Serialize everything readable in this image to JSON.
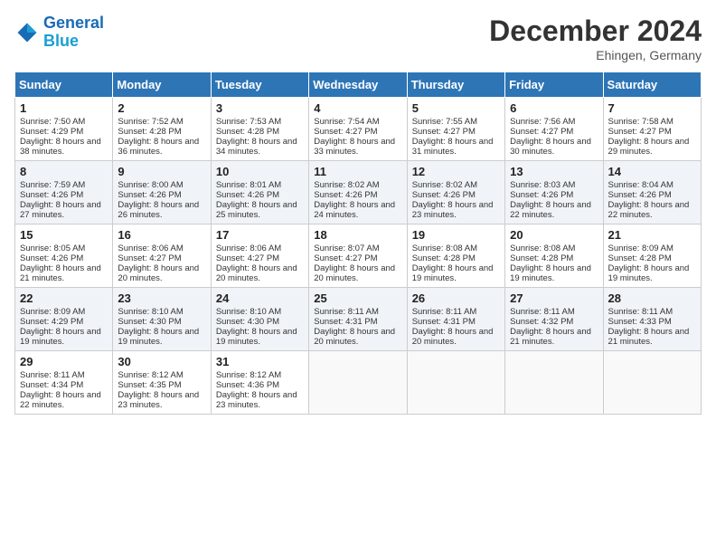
{
  "header": {
    "logo_line1": "General",
    "logo_line2": "Blue",
    "month": "December 2024",
    "location": "Ehingen, Germany"
  },
  "days_of_week": [
    "Sunday",
    "Monday",
    "Tuesday",
    "Wednesday",
    "Thursday",
    "Friday",
    "Saturday"
  ],
  "weeks": [
    [
      {
        "day": 1,
        "sunrise": "Sunrise: 7:50 AM",
        "sunset": "Sunset: 4:29 PM",
        "daylight": "Daylight: 8 hours and 38 minutes."
      },
      {
        "day": 2,
        "sunrise": "Sunrise: 7:52 AM",
        "sunset": "Sunset: 4:28 PM",
        "daylight": "Daylight: 8 hours and 36 minutes."
      },
      {
        "day": 3,
        "sunrise": "Sunrise: 7:53 AM",
        "sunset": "Sunset: 4:28 PM",
        "daylight": "Daylight: 8 hours and 34 minutes."
      },
      {
        "day": 4,
        "sunrise": "Sunrise: 7:54 AM",
        "sunset": "Sunset: 4:27 PM",
        "daylight": "Daylight: 8 hours and 33 minutes."
      },
      {
        "day": 5,
        "sunrise": "Sunrise: 7:55 AM",
        "sunset": "Sunset: 4:27 PM",
        "daylight": "Daylight: 8 hours and 31 minutes."
      },
      {
        "day": 6,
        "sunrise": "Sunrise: 7:56 AM",
        "sunset": "Sunset: 4:27 PM",
        "daylight": "Daylight: 8 hours and 30 minutes."
      },
      {
        "day": 7,
        "sunrise": "Sunrise: 7:58 AM",
        "sunset": "Sunset: 4:27 PM",
        "daylight": "Daylight: 8 hours and 29 minutes."
      }
    ],
    [
      {
        "day": 8,
        "sunrise": "Sunrise: 7:59 AM",
        "sunset": "Sunset: 4:26 PM",
        "daylight": "Daylight: 8 hours and 27 minutes."
      },
      {
        "day": 9,
        "sunrise": "Sunrise: 8:00 AM",
        "sunset": "Sunset: 4:26 PM",
        "daylight": "Daylight: 8 hours and 26 minutes."
      },
      {
        "day": 10,
        "sunrise": "Sunrise: 8:01 AM",
        "sunset": "Sunset: 4:26 PM",
        "daylight": "Daylight: 8 hours and 25 minutes."
      },
      {
        "day": 11,
        "sunrise": "Sunrise: 8:02 AM",
        "sunset": "Sunset: 4:26 PM",
        "daylight": "Daylight: 8 hours and 24 minutes."
      },
      {
        "day": 12,
        "sunrise": "Sunrise: 8:02 AM",
        "sunset": "Sunset: 4:26 PM",
        "daylight": "Daylight: 8 hours and 23 minutes."
      },
      {
        "day": 13,
        "sunrise": "Sunrise: 8:03 AM",
        "sunset": "Sunset: 4:26 PM",
        "daylight": "Daylight: 8 hours and 22 minutes."
      },
      {
        "day": 14,
        "sunrise": "Sunrise: 8:04 AM",
        "sunset": "Sunset: 4:26 PM",
        "daylight": "Daylight: 8 hours and 22 minutes."
      }
    ],
    [
      {
        "day": 15,
        "sunrise": "Sunrise: 8:05 AM",
        "sunset": "Sunset: 4:26 PM",
        "daylight": "Daylight: 8 hours and 21 minutes."
      },
      {
        "day": 16,
        "sunrise": "Sunrise: 8:06 AM",
        "sunset": "Sunset: 4:27 PM",
        "daylight": "Daylight: 8 hours and 20 minutes."
      },
      {
        "day": 17,
        "sunrise": "Sunrise: 8:06 AM",
        "sunset": "Sunset: 4:27 PM",
        "daylight": "Daylight: 8 hours and 20 minutes."
      },
      {
        "day": 18,
        "sunrise": "Sunrise: 8:07 AM",
        "sunset": "Sunset: 4:27 PM",
        "daylight": "Daylight: 8 hours and 20 minutes."
      },
      {
        "day": 19,
        "sunrise": "Sunrise: 8:08 AM",
        "sunset": "Sunset: 4:28 PM",
        "daylight": "Daylight: 8 hours and 19 minutes."
      },
      {
        "day": 20,
        "sunrise": "Sunrise: 8:08 AM",
        "sunset": "Sunset: 4:28 PM",
        "daylight": "Daylight: 8 hours and 19 minutes."
      },
      {
        "day": 21,
        "sunrise": "Sunrise: 8:09 AM",
        "sunset": "Sunset: 4:28 PM",
        "daylight": "Daylight: 8 hours and 19 minutes."
      }
    ],
    [
      {
        "day": 22,
        "sunrise": "Sunrise: 8:09 AM",
        "sunset": "Sunset: 4:29 PM",
        "daylight": "Daylight: 8 hours and 19 minutes."
      },
      {
        "day": 23,
        "sunrise": "Sunrise: 8:10 AM",
        "sunset": "Sunset: 4:30 PM",
        "daylight": "Daylight: 8 hours and 19 minutes."
      },
      {
        "day": 24,
        "sunrise": "Sunrise: 8:10 AM",
        "sunset": "Sunset: 4:30 PM",
        "daylight": "Daylight: 8 hours and 19 minutes."
      },
      {
        "day": 25,
        "sunrise": "Sunrise: 8:11 AM",
        "sunset": "Sunset: 4:31 PM",
        "daylight": "Daylight: 8 hours and 20 minutes."
      },
      {
        "day": 26,
        "sunrise": "Sunrise: 8:11 AM",
        "sunset": "Sunset: 4:31 PM",
        "daylight": "Daylight: 8 hours and 20 minutes."
      },
      {
        "day": 27,
        "sunrise": "Sunrise: 8:11 AM",
        "sunset": "Sunset: 4:32 PM",
        "daylight": "Daylight: 8 hours and 21 minutes."
      },
      {
        "day": 28,
        "sunrise": "Sunrise: 8:11 AM",
        "sunset": "Sunset: 4:33 PM",
        "daylight": "Daylight: 8 hours and 21 minutes."
      }
    ],
    [
      {
        "day": 29,
        "sunrise": "Sunrise: 8:11 AM",
        "sunset": "Sunset: 4:34 PM",
        "daylight": "Daylight: 8 hours and 22 minutes."
      },
      {
        "day": 30,
        "sunrise": "Sunrise: 8:12 AM",
        "sunset": "Sunset: 4:35 PM",
        "daylight": "Daylight: 8 hours and 23 minutes."
      },
      {
        "day": 31,
        "sunrise": "Sunrise: 8:12 AM",
        "sunset": "Sunset: 4:36 PM",
        "daylight": "Daylight: 8 hours and 23 minutes."
      },
      null,
      null,
      null,
      null
    ]
  ]
}
